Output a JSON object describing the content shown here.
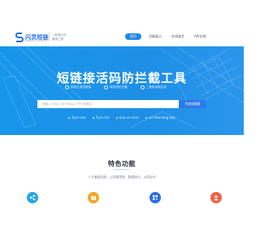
{
  "header": {
    "logo_text": "闪灵短链",
    "logo_sub": "SHANLING DUANLIAN",
    "slogan_line1": "一款强大的",
    "slogan_line2": "营销工具",
    "nav": [
      {
        "label": "首页",
        "active": true
      },
      {
        "label": "功能展示",
        "active": false
      },
      {
        "label": "在线留言",
        "active": false
      },
      {
        "label": "API文档",
        "active": false
      }
    ]
  },
  "hero": {
    "title": "短链接活码防拦截工具",
    "features": [
      "网址生成短链接",
      "域名防红拦截",
      "二维码活码生成"
    ],
    "search_placeholder": "请输入 http:// 或 https:// 开头的网址",
    "search_button": "生成短链接",
    "domains": [
      "5ym.me",
      "7ym.me",
      "kuo.cn.com",
      "url.shanling.top"
    ]
  },
  "features_section": {
    "title": "特色功能",
    "description": "八大基础功能，让您做营销、数据统计，从容应对"
  },
  "feature_icons": [
    "share-icon",
    "gift-icon",
    "qrcode-icon",
    "user-icon"
  ],
  "colors": {
    "primary": "#1f86e8",
    "hero_bg": "#1e8fe6",
    "icon1": "#25a6e6",
    "icon2": "#f5a623",
    "icon3": "#2b6ee8",
    "icon4": "#f0624a"
  }
}
